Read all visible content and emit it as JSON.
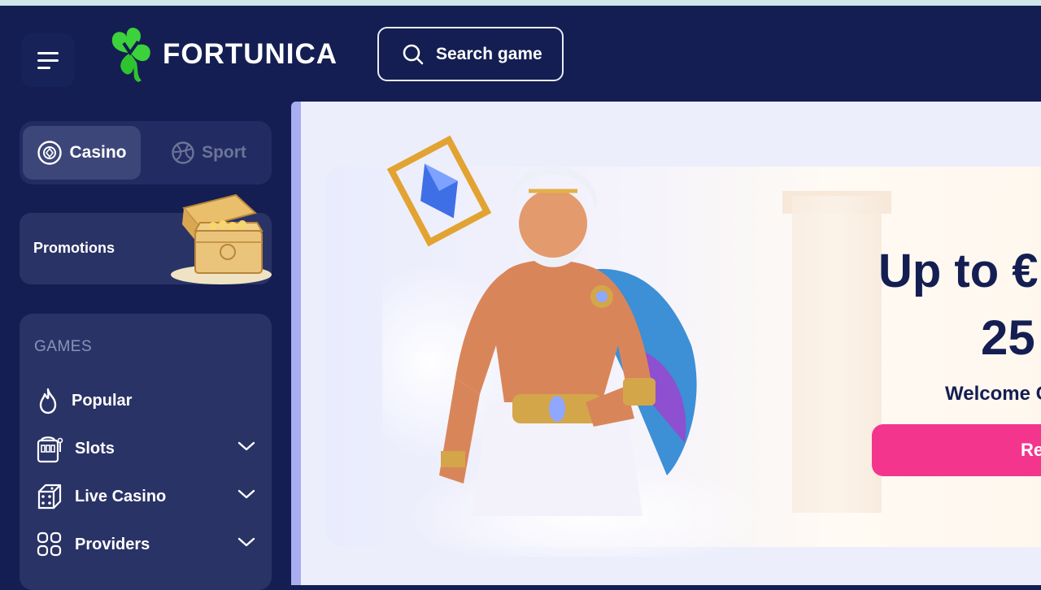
{
  "header": {
    "logo_text": "FORTUNICA",
    "search_label": "Search game"
  },
  "sidebar": {
    "switch": {
      "casino": "Casino",
      "sport": "Sport"
    },
    "promotions_label": "Promotions",
    "games": {
      "title": "GAMES",
      "items": [
        {
          "label": "Popular",
          "icon": "flame-icon",
          "expandable": false
        },
        {
          "label": "Slots",
          "icon": "slot-machine-icon",
          "expandable": true
        },
        {
          "label": "Live Casino",
          "icon": "dice-icon",
          "expandable": true
        },
        {
          "label": "Providers",
          "icon": "grid-icon",
          "expandable": true
        }
      ]
    }
  },
  "banner": {
    "headline": "Up to €",
    "amount": "25",
    "welcome": "Welcome C",
    "cta_label": "Re"
  },
  "colors": {
    "navy": "#141e52",
    "panel": "#2a3366",
    "cta_pink": "#f4358d",
    "logo_green": "#3bd23b"
  }
}
